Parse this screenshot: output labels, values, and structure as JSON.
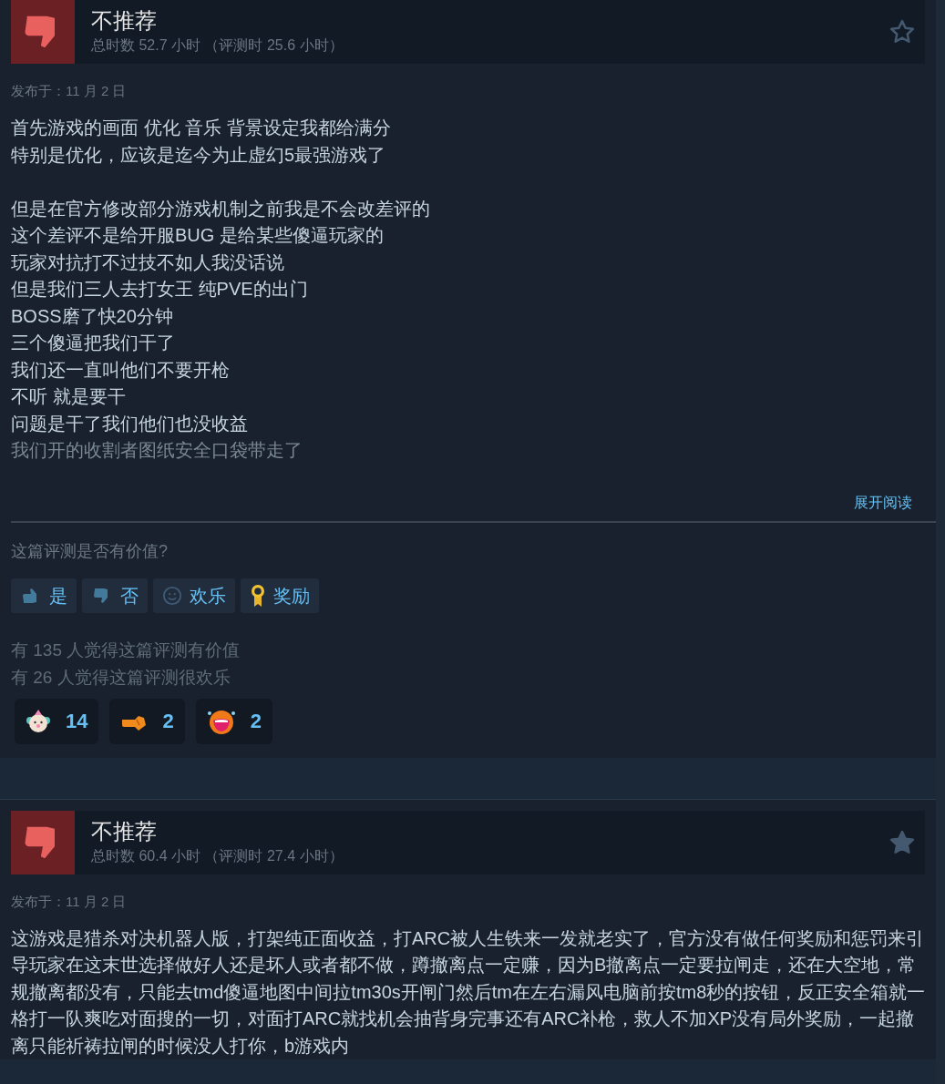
{
  "reviews": [
    {
      "verdict": "不推荐",
      "hours": "总时数 52.7 小时 （评测时 25.6 小时）",
      "starred": false,
      "posted": "发布于：11 月 2 日",
      "paragraphs": [
        [
          "首先游戏的画面 优化 音乐 背景设定我都给满分",
          "特别是优化，应该是迄今为止虚幻5最强游戏了"
        ],
        [
          "但是在官方修改部分游戏机制之前我是不会改差评的",
          "这个差评不是给开服BUG 是给某些傻逼玩家的",
          "玩家对抗打不过技不如人我没话说",
          "但是我们三人去打女王 纯PVE的出门",
          "BOSS磨了快20分钟",
          "三个傻逼把我们干了",
          "我们还一直叫他们不要开枪",
          "不听 就是要干",
          "问题是干了我们他们也没收益",
          "我们开的收割者图纸安全口袋带走了"
        ]
      ],
      "expand_link": "展开阅读",
      "helpful_prompt": "这篇评测是否有价值?",
      "vote_buttons": [
        {
          "kind": "yes",
          "label": "是"
        },
        {
          "kind": "no",
          "label": "否"
        },
        {
          "kind": "funny",
          "label": "欢乐"
        },
        {
          "kind": "award",
          "label": "奖励"
        }
      ],
      "stats": [
        "有 135 人觉得这篇评测有价值",
        "有 26 人觉得这篇评测很欢乐"
      ],
      "reactions": [
        {
          "kind": "clown",
          "count": "14"
        },
        {
          "kind": "hand",
          "count": "2"
        },
        {
          "kind": "laugh",
          "count": "2"
        }
      ]
    },
    {
      "verdict": "不推荐",
      "hours": "总时数 60.4 小时 （评测时 27.4 小时）",
      "starred": true,
      "posted": "发布于：11 月 2 日",
      "paragraphs": [
        [
          "这游戏是猎杀对决机器人版，打架纯正面收益，打ARC被人生铁来一发就老实了，官方没有做任何奖励和惩罚来引导玩家在这末世选择做好人还是坏人或者都不做，蹲撤离点一定赚，因为B撤离点一定要拉闸走，还在大空地，常规撤离都没有，只能去tmd傻逼地图中间拉tm30s开闸门然后tm在左右漏风电脑前按tm8秒的按钮，反正安全箱就一格打一队爽吃对面搜的一切，对面打ARC就找机会抽背身完事还有ARC补枪，救人不加XP没有局外奖励，一起撤离只能祈祷拉闸的时候没人打你，b游戏内"
        ]
      ]
    }
  ]
}
